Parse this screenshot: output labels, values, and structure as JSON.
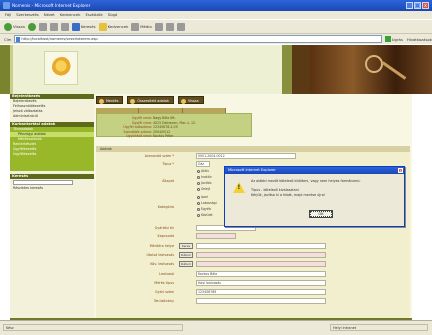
{
  "window": {
    "title": "Nomenis - Microsoft Internet Explorer",
    "minimize": "_",
    "maximize": "□",
    "close": "x"
  },
  "menu": [
    "Fájl",
    "Szerkesztés",
    "Nézet",
    "Kedvencek",
    "Eszközök",
    "Súgó"
  ],
  "toolbar": {
    "back": "Vissza",
    "search": "Keresés",
    "favorites": "Kedvencek",
    "media": "Média"
  },
  "address": {
    "label": "Cím",
    "url": "http://localhost/nomenis/vezerloterem.asp",
    "go": "Ugrás",
    "links": "Hivatkozások"
  },
  "sidebar": {
    "header1": "Bejelentkezés",
    "items1": [
      "Bejelentkezés",
      "Felhasználókezelés",
      "Jelszó változtatás",
      "Adminisztráció"
    ],
    "header2": "Karbantartási adatok",
    "green_items": [
      "Törzsadatok",
      "Pénzügyi adatok",
      "Mérőeszközök",
      "Raktárkészlet",
      "Ügyfélkezelés",
      "Ügyfélkezelés"
    ],
    "header3": "Keresés",
    "search_label": "Részletes keresés"
  },
  "content": {
    "toolbar": [
      "Mentés",
      "Összesített adatok",
      "Vissza"
    ],
    "info": [
      {
        "k": "Ügyfél neve:",
        "v": "Nagy Béla Kft."
      },
      {
        "k": "Ügyfél címe:",
        "v": "4025 Debrecen, Piac u. 12."
      },
      {
        "k": "Ügyfél adószáma:",
        "v": "12345678-2-09"
      },
      {
        "k": "Szerződés száma:",
        "v": "2004/0012"
      },
      {
        "k": "Ügyintéző neve:",
        "v": "Kovács Péter"
      }
    ],
    "form_header": "Adatok",
    "fields": [
      {
        "label": "Azonosító szám *",
        "value": "0001-2004-0012"
      },
      {
        "label": "Típus *",
        "value": "Gáz"
      },
      {
        "label": "Állapot",
        "options": [
          "Aktív",
          "Inaktív",
          "Javítás",
          "Selejt"
        ]
      },
      {
        "label": "Kategória",
        "options": [
          "Ipari",
          "Lakossági",
          "Egyéb",
          "Közület"
        ]
      },
      {
        "label": "Gyártási év",
        "value": ""
      },
      {
        "label": "Kapcsolat",
        "value": ""
      },
      {
        "label": "Mérőóra helye",
        "value": "",
        "btn": "Keres"
      },
      {
        "label": "Utolsó leolvasás",
        "value": "",
        "btn": "Dátum"
      },
      {
        "label": "Köv. leolvasás",
        "value": "",
        "btn": "Dátum"
      },
      {
        "label": "Leolvasó",
        "value": "Kovács Béla"
      },
      {
        "label": "Mérés típus",
        "value": "Havi leolvasás"
      },
      {
        "label": "Gyári szám",
        "value": "123456789"
      },
      {
        "label": "Tanúsítvány",
        "value": ""
      }
    ]
  },
  "dialog": {
    "title": "Microsoft Internet Explorer",
    "close": "x",
    "line1": "Az alábbi mezőt kötelező kitölteni, vagy nem helyes formátumú:",
    "line2": "Típus - kötelező kiválasztani",
    "line3": "Kérjük, javítsa ki a hibát, majd mentse újra!",
    "ok": "OK"
  },
  "status": {
    "left": "Kész",
    "right": "Helyi intranet"
  }
}
